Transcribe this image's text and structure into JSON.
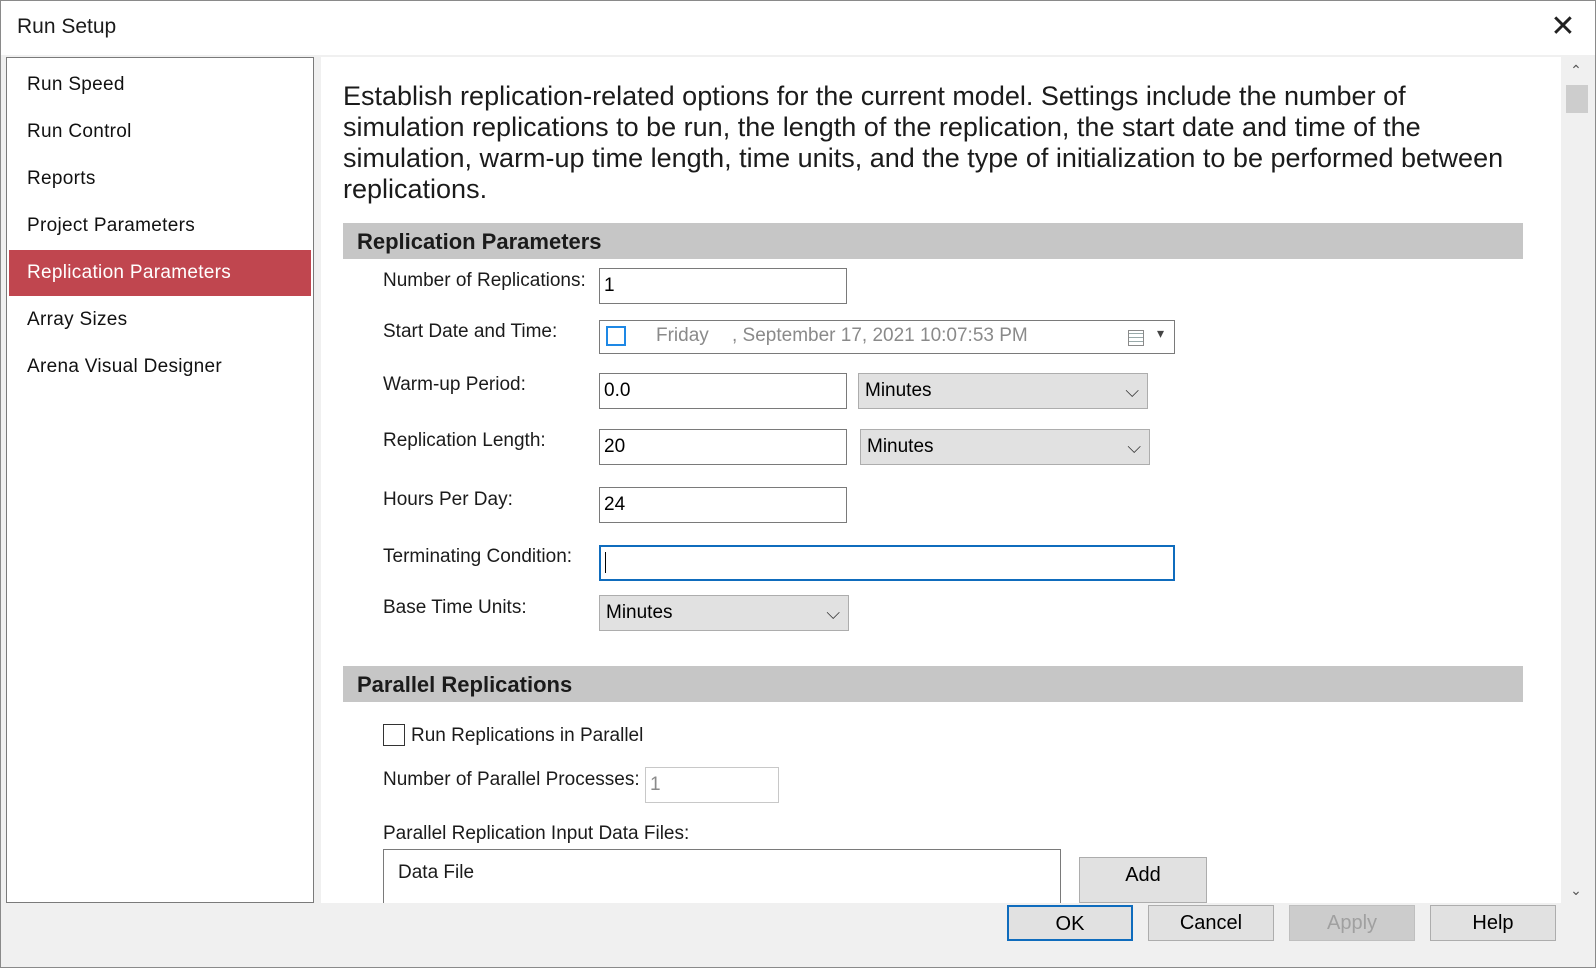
{
  "window": {
    "title": "Run Setup",
    "close_glyph": "✕"
  },
  "sidebar": {
    "items": [
      {
        "label": "Run Speed"
      },
      {
        "label": "Run Control"
      },
      {
        "label": "Reports"
      },
      {
        "label": "Project Parameters"
      },
      {
        "label": "Replication Parameters",
        "selected": true
      },
      {
        "label": "Array Sizes"
      },
      {
        "label": "Arena Visual Designer"
      }
    ],
    "selected_color": "#c0464f"
  },
  "description": "Establish replication-related options for the current model.  Settings include the number of simulation replications to be run, the length of the replication, the start date and time of the simulation, warm-up time length, time units, and the type of initialization to be performed between replications.",
  "replication_parameters": {
    "header": "Replication Parameters",
    "num_replications": {
      "label": "Number of Replications:",
      "value": "1"
    },
    "start_datetime": {
      "label": "Start Date and Time:",
      "day": "Friday",
      "date": ", September 17, 2021  10:07:53 PM",
      "checked": false
    },
    "warmup": {
      "label": "Warm-up Period:",
      "value": "0.0",
      "units": "Minutes"
    },
    "rep_length": {
      "label": "Replication Length:",
      "value": "20",
      "units": "Minutes"
    },
    "hours_per_day": {
      "label": "Hours Per Day:",
      "value": "24"
    },
    "terminating_condition": {
      "label": "Terminating Condition:",
      "value": ""
    },
    "base_time_units": {
      "label": "Base Time Units:",
      "value": "Minutes"
    }
  },
  "parallel_replications": {
    "header": "Parallel Replications",
    "run_parallel": {
      "label": "Run Replications in Parallel",
      "checked": false
    },
    "num_processes": {
      "label": "Number of Parallel Processes:",
      "value": "1"
    },
    "input_files": {
      "label": "Parallel Replication Input Data Files:",
      "column_header": "Data File"
    },
    "add_label": "Add"
  },
  "footer": {
    "ok": "OK",
    "cancel": "Cancel",
    "apply": "Apply",
    "help": "Help"
  },
  "icons": {
    "chevron": "⌵",
    "scroll_up": "⌃",
    "scroll_down": "⌄",
    "dropdown_arrow": "▾"
  }
}
